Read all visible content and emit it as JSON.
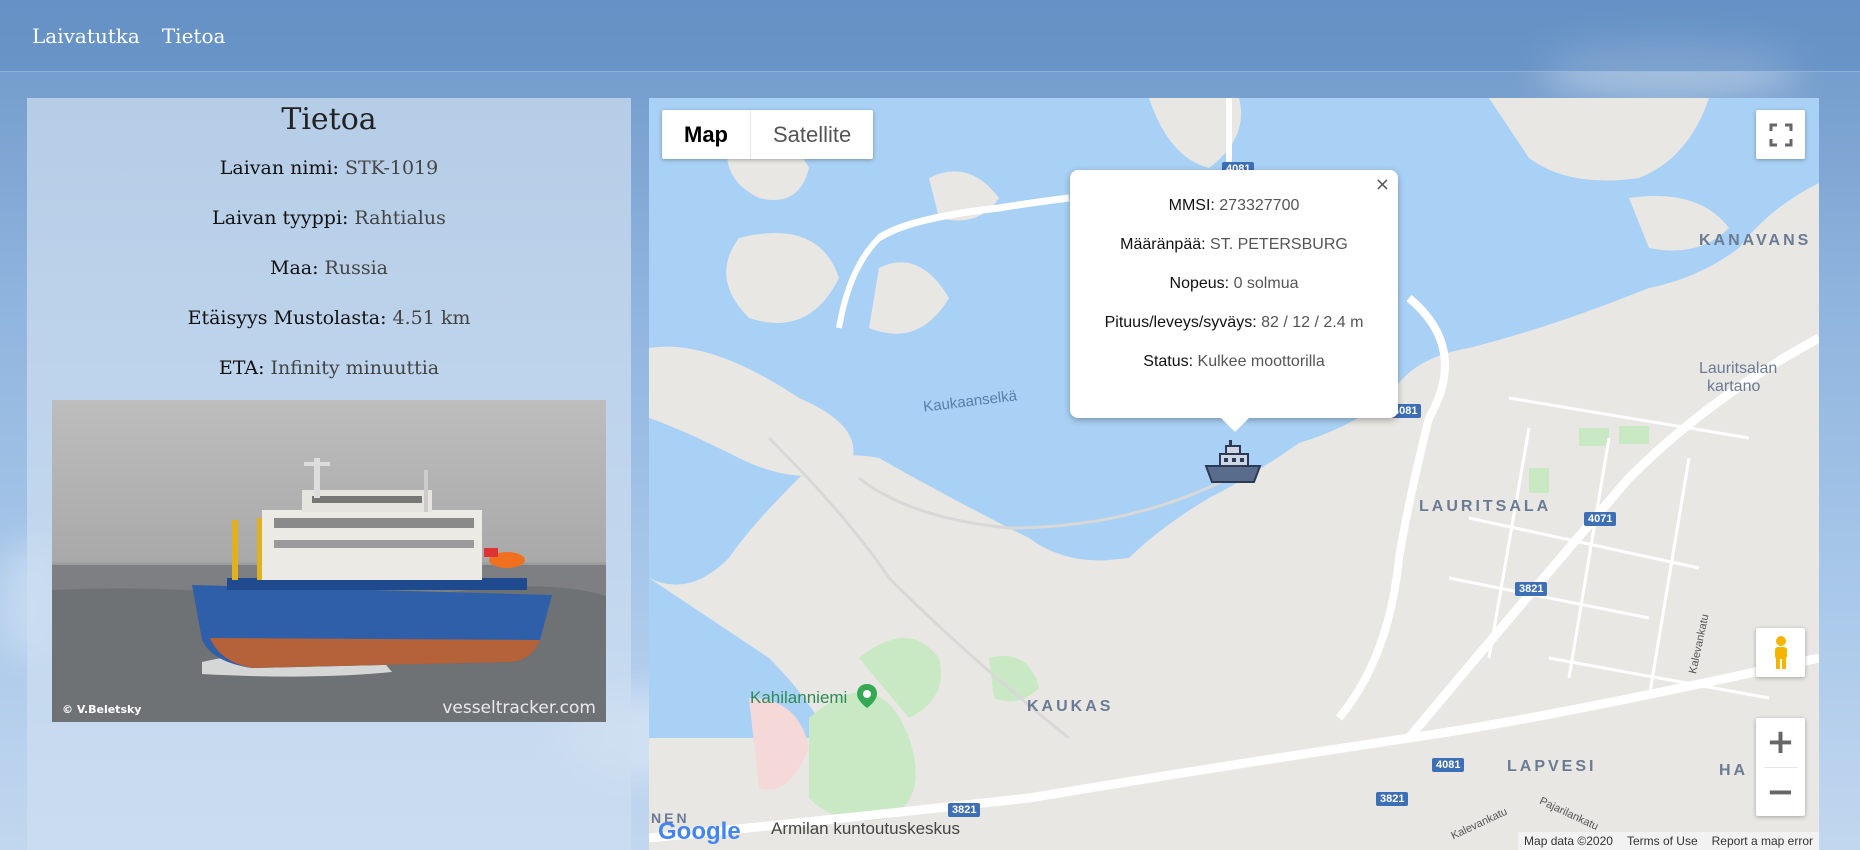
{
  "nav": {
    "links": [
      "Laivatutka",
      "Tietoa"
    ]
  },
  "info": {
    "title": "Tietoa",
    "rows": [
      {
        "label": "Laivan nimi:",
        "value": "STK-1019"
      },
      {
        "label": "Laivan tyyppi:",
        "value": "Rahtialus"
      },
      {
        "label": "Maa:",
        "value": "Russia"
      },
      {
        "label": "Etäisyys Mustolasta:",
        "value": "4.51 km"
      },
      {
        "label": "ETA:",
        "value": "Infinity minuuttia"
      }
    ],
    "photo": {
      "credit": "© V.Beletsky",
      "watermark": "vesseltracker.com"
    }
  },
  "map": {
    "type_buttons": [
      "Map",
      "Satellite"
    ],
    "active_type": "Map",
    "infowindow": {
      "close": "×",
      "rows": [
        {
          "label": "MMSI:",
          "value": "273327700"
        },
        {
          "label": "Määränpää:",
          "value": "ST. PETERSBURG"
        },
        {
          "label": "Nopeus:",
          "value": "0 solmua"
        },
        {
          "label": "Pituus/leveys/syväys:",
          "value": "82 / 12 / 2.4 m"
        },
        {
          "label": "Status:",
          "value": "Kulkee moottorilla"
        }
      ]
    },
    "labels": {
      "kanavansuu": "KANAVANS",
      "lauritsalan_kartano_1": "Lauritsalan",
      "lauritsalan_kartano_2": "kartano",
      "lauritsala": "LAURITSALA",
      "kaukas": "KAUKAS",
      "lapvesi": "LAPVESI",
      "ha": "HA",
      "nen": "NEN",
      "water": "Kaukaanselkä",
      "kahilanniemi": "Kahilanniemi",
      "armila": "Armilan kuntoutuskeskus",
      "kalevankatu_1": "Kalevankatu",
      "kalevankatu_2": "Kalevankatu",
      "pajarilankatu": "Pajarilankatu"
    },
    "shields": [
      "4081",
      "4081",
      "4071",
      "3821",
      "4081",
      "3821",
      "3821"
    ],
    "footer": {
      "data": "Map data ©2020",
      "terms": "Terms of Use",
      "report": "Report a map error"
    },
    "logo": "Google"
  }
}
